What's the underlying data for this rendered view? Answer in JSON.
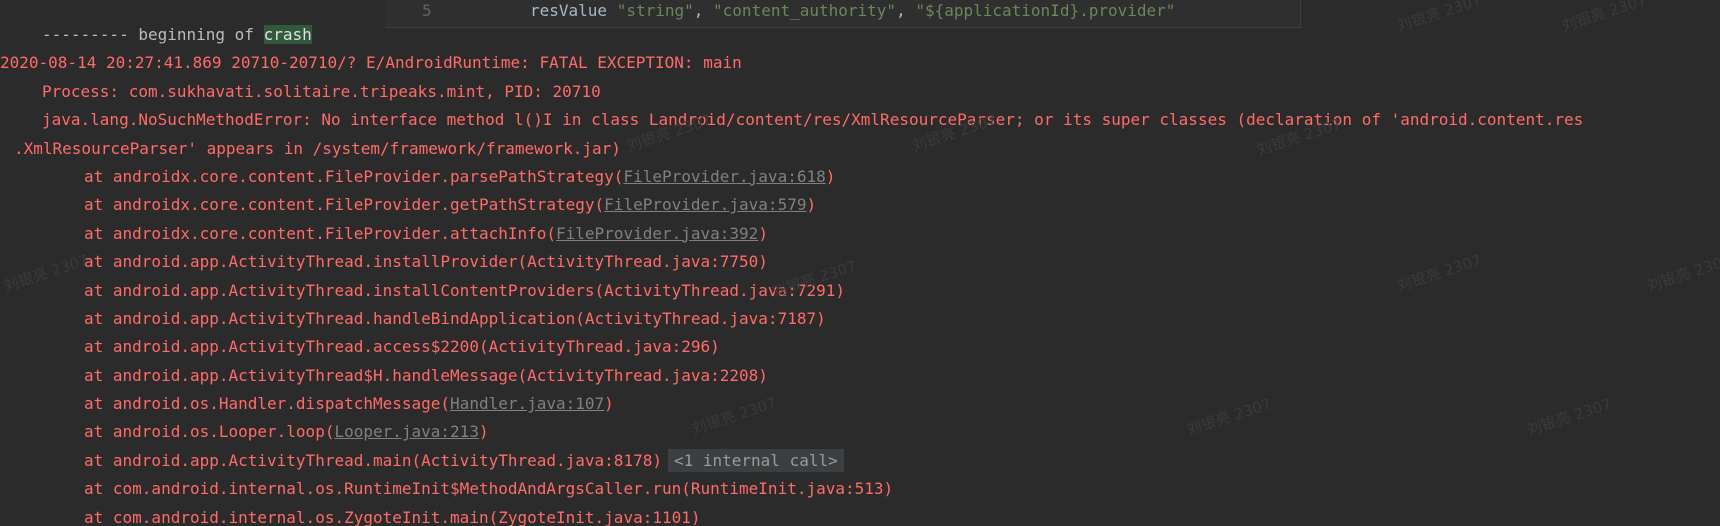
{
  "code_popup": {
    "line_number": "5",
    "keyword": "resValue",
    "arg1": "\"string\"",
    "arg2": "\"content_authority\"",
    "arg3": "\"${applicationId}.provider\""
  },
  "log": {
    "crash_prefix": "--------- beginning of ",
    "crash_word": "crash",
    "header": "2020-08-14 20:27:41.869 20710-20710/? E/AndroidRuntime: FATAL EXCEPTION: main",
    "process": "Process: com.sukhavati.solitaire.tripeaks.mint, PID: 20710",
    "error_line1": "java.lang.NoSuchMethodError: No interface method l()I in class Landroid/content/res/XmlResourceParser; or its super classes (declaration of 'android.content.res",
    "error_line2": ".XmlResourceParser' appears in /system/framework/framework.jar)",
    "frames": [
      {
        "method": "at androidx.core.content.FileProvider.parsePathStrategy(",
        "link": "FileProvider.java:618",
        "suffix": ")"
      },
      {
        "method": "at androidx.core.content.FileProvider.getPathStrategy(",
        "link": "FileProvider.java:579",
        "suffix": ")"
      },
      {
        "method": "at androidx.core.content.FileProvider.attachInfo(",
        "link": "FileProvider.java:392",
        "suffix": ")"
      },
      {
        "method": "at android.app.ActivityThread.installProvider(ActivityThread.java:7750)"
      },
      {
        "method": "at android.app.ActivityThread.installContentProviders(ActivityThread.java:7291)"
      },
      {
        "method": "at android.app.ActivityThread.handleBindApplication(ActivityThread.java:7187)"
      },
      {
        "method": "at android.app.ActivityThread.access$2200(ActivityThread.java:296)"
      },
      {
        "method": "at android.app.ActivityThread$H.handleMessage(ActivityThread.java:2208)"
      },
      {
        "method": "at android.os.Handler.dispatchMessage(",
        "link": "Handler.java:107",
        "suffix": ")"
      },
      {
        "method": "at android.os.Looper.loop(",
        "link": "Looper.java:213",
        "suffix": ")"
      },
      {
        "method": "at android.app.ActivityThread.main(ActivityThread.java:8178)",
        "fold": "<1 internal call>"
      },
      {
        "method": "at com.android.internal.os.RuntimeInit$MethodAndArgsCaller.run(RuntimeInit.java:513)"
      },
      {
        "method": "at com.android.internal.os.ZygoteInit.main(ZygoteInit.java:1101)"
      }
    ]
  },
  "watermark": {
    "text": "刘银亮 2307"
  },
  "colors": {
    "background": "#2b2b2b",
    "error_text": "#ff6b68",
    "info_text": "#bbbbbb",
    "link_text": "#808080",
    "highlight_bg": "#32593d"
  }
}
